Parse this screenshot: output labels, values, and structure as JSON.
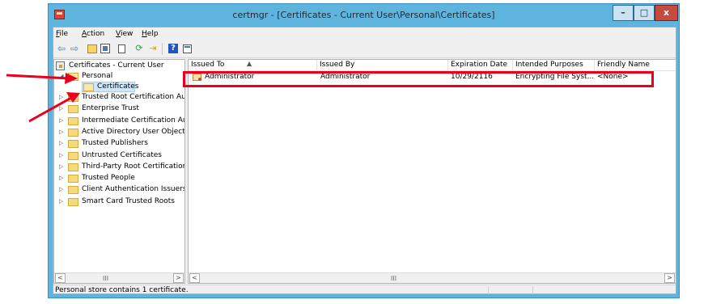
{
  "window": {
    "title": "certmgr - [Certificates - Current User\\Personal\\Certificates]",
    "buttons": {
      "minimize": "–",
      "maximize": "□",
      "close": "x"
    }
  },
  "menu": [
    {
      "label": "File",
      "accesskey": "F"
    },
    {
      "label": "Action",
      "accesskey": "A"
    },
    {
      "label": "View",
      "accesskey": "V"
    },
    {
      "label": "Help",
      "accesskey": "H"
    }
  ],
  "toolbar": {
    "icons": [
      "back-arrow-icon",
      "forward-arrow-icon",
      "up-folder-icon",
      "show-hide-tree-icon",
      "copy-icon",
      "refresh-icon",
      "export-list-icon",
      "help-icon",
      "properties-icon"
    ],
    "help_glyph": "?"
  },
  "tree": {
    "root": "Certificates - Current User",
    "personal": "Personal",
    "certificates": "Certificates",
    "stores": [
      "Trusted Root Certification Au",
      "Enterprise Trust",
      "Intermediate Certification Au",
      "Active Directory User Object",
      "Trusted Publishers",
      "Untrusted Certificates",
      "Third-Party Root Certification",
      "Trusted People",
      "Client Authentication Issuers",
      "Smart Card Trusted Roots"
    ],
    "expander_glyph": "▷",
    "expanded_glyph": "◢"
  },
  "list": {
    "columns": [
      "Issued To",
      "Issued By",
      "Expiration Date",
      "Intended Purposes",
      "Friendly Name"
    ],
    "rows": [
      {
        "issued_to": "Administrator",
        "issued_by": "Administrator",
        "expiration": "10/29/2116",
        "purposes": "Encrypting File Syst...",
        "friendly_name": "<None>"
      }
    ]
  },
  "scroll": {
    "left": "<",
    "right": ">",
    "thumb": "III"
  },
  "status": {
    "text": "Personal store contains 1 certificate."
  },
  "colors": {
    "annotation": "#e8001d",
    "frame": "#5fb4dd",
    "selection": "#cce8ff"
  }
}
